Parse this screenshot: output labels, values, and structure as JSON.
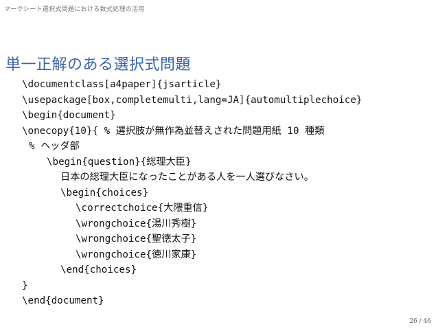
{
  "header": {
    "running_title": "マークシート選択式問題における数式処理の活用"
  },
  "slide": {
    "title": "単一正解のある選択式問題"
  },
  "code_lines": [
    "\\documentclass[a4paper]{jsarticle}",
    "\\usepackage[box,completemulti,lang=JA]{automultiplechoice}",
    "\\begin{document}",
    "\\onecopy{10}{ % 選択肢が無作為並替えされた問題用紙 10 種類",
    "% ヘッダ部",
    "\\begin{question}{総理大臣}",
    "日本の総理大臣になったことがある人を一人選びなさい。",
    "\\begin{choices}",
    "\\correctchoice{大隈重信}",
    "\\wrongchoice{湯川秀樹}",
    "\\wrongchoice{聖徳太子}",
    "\\wrongchoice{徳川家康}",
    "\\end{choices}",
    "}",
    "\\end{document}"
  ],
  "footer": {
    "page_number": "26 / 46"
  }
}
